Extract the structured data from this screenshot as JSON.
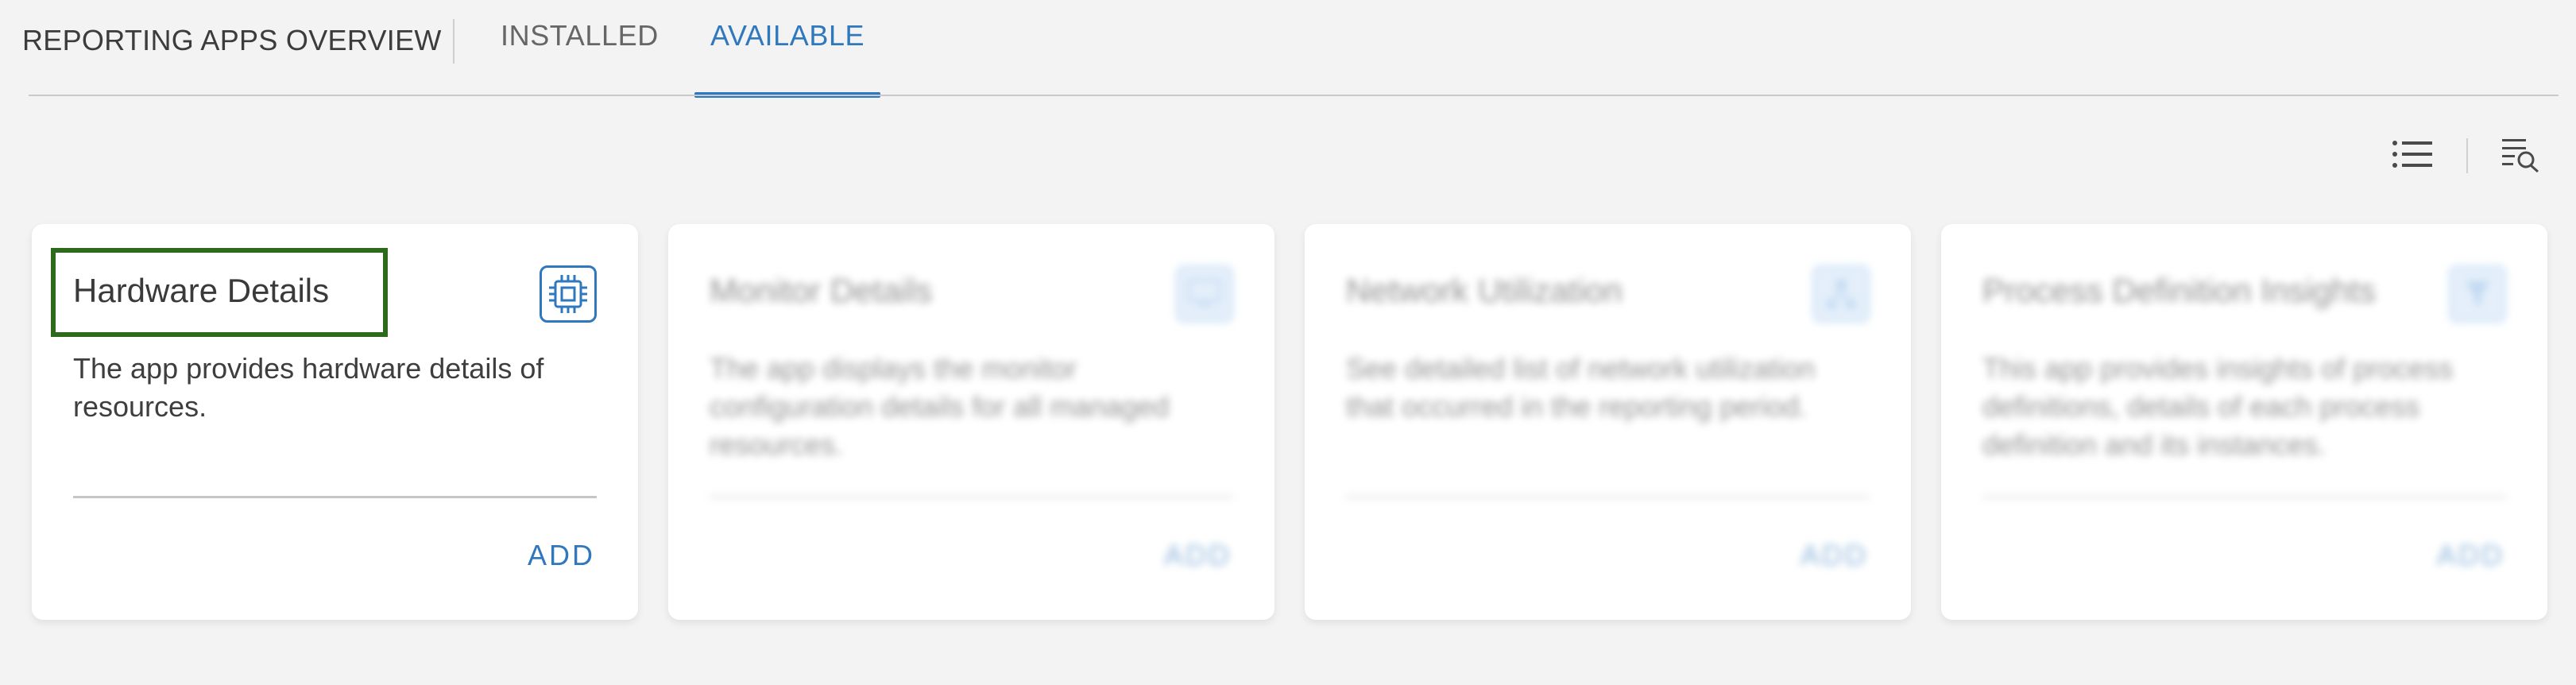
{
  "header": {
    "title": "REPORTING APPS OVERVIEW",
    "tabs": [
      {
        "label": "INSTALLED"
      },
      {
        "label": "AVAILABLE"
      }
    ]
  },
  "toolbar": {
    "list_view_icon": "list-view-icon",
    "search_filter_icon": "search-filter-icon"
  },
  "cards": [
    {
      "title": "Hardware Details",
      "description": "The app provides hardware details of resources.",
      "action": "ADD",
      "icon": "chip-icon"
    },
    {
      "title": "Monitor Details",
      "description": "The app displays the monitor configuration details for all managed resources.",
      "action": "ADD",
      "icon": "monitor-icon"
    },
    {
      "title": "Network Utilization",
      "description": "See detailed list of network utilization that occurred in the reporting period.",
      "action": "ADD",
      "icon": "network-icon"
    },
    {
      "title": "Process Definition Insights",
      "description": "This app provides insights of process definitions, details of each process definition and its instances.",
      "action": "ADD",
      "icon": "process-icon"
    }
  ],
  "colors": {
    "accent": "#2f78bd",
    "highlight": "#2e6a1c",
    "background": "#f3f3f3"
  }
}
